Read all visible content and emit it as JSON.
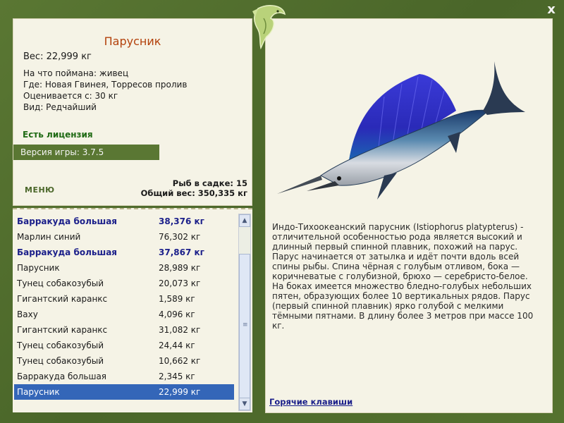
{
  "window": {
    "close_label": "x"
  },
  "fish": {
    "title": "Парусник",
    "weight_line": "Вес: 22,999 кг",
    "details": [
      "На что поймана: живец",
      "Где: Новая Гвинея, Торресов пролив",
      "Оценивается с: 30 кг",
      "Вид: Редчайший"
    ],
    "description": "Индо-Тихоокеанский парусник (Istiophorus platypterus) - отличительной особенностью рода является высокий и длинный первый спинной плавник, похожий на парус. Парус начинается от затылка и идёт почти вдоль всей спины рыбы. Спина чёрная с голубым отливом, бока — коричневатые с голубизной, брюхо — серебристо-белое. На боках имеется множество бледно-голубых небольших пятен, образующих более 10 вертикальных рядов. Парус (первый спинной плавник) ярко голубой с мелкими тёмными пятнами. В длину более 3 метров при массе 100 кг."
  },
  "license_label": "Есть лицензия",
  "version_label": "Версия игры: 3.7.5",
  "menu_label": "МЕНЮ",
  "stats": {
    "fish_count": "Рыб в садке: 15",
    "total_weight": "Общий вес: 350,335 кг"
  },
  "catch_list": [
    {
      "name": "Барракуда большая",
      "weight": "38,376 кг",
      "bold": true
    },
    {
      "name": "Марлин синий",
      "weight": "76,302 кг",
      "bold": false
    },
    {
      "name": "Барракуда большая",
      "weight": "37,867 кг",
      "bold": true
    },
    {
      "name": "Парусник",
      "weight": "28,989 кг",
      "bold": false
    },
    {
      "name": "Тунец собакозубый",
      "weight": "20,073 кг",
      "bold": false
    },
    {
      "name": "Гигантский каранкс",
      "weight": "1,589 кг",
      "bold": false
    },
    {
      "name": "Ваху",
      "weight": "4,096 кг",
      "bold": false
    },
    {
      "name": "Гигантский каранкс",
      "weight": "31,082 кг",
      "bold": false
    },
    {
      "name": "Тунец собакозубый",
      "weight": "24,44 кг",
      "bold": false
    },
    {
      "name": "Тунец собакозубый",
      "weight": "10,662 кг",
      "bold": false
    },
    {
      "name": "Барракуда большая",
      "weight": "2,345 кг",
      "bold": false
    },
    {
      "name": "Парусник",
      "weight": "22,999 кг",
      "bold": false,
      "selected": true
    }
  ],
  "hotkeys_label": "Горячие клавиши",
  "colors": {
    "frame": "#4e6a2c",
    "panel": "#f5f3e6",
    "title": "#b3410b",
    "license": "#1f6a14",
    "selection": "#3466b8",
    "link": "#1b1f8a"
  },
  "icons": {
    "logo": "leaping-fish-logo",
    "close": "close-icon",
    "fish_picture": "sailfish-picture"
  }
}
